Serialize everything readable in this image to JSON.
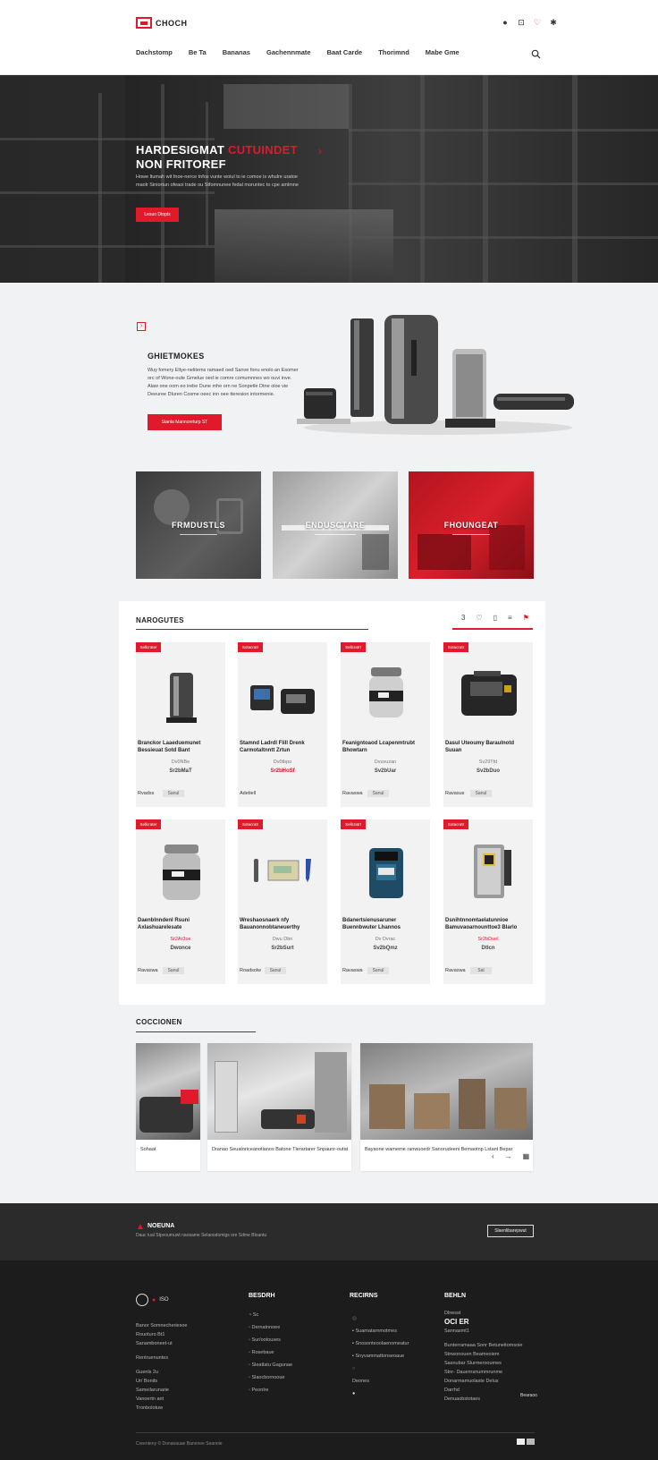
{
  "header": {
    "brand": "CHOCH",
    "nav": [
      "Dachstomp",
      "Be Ta",
      "Bananas",
      "Gachennmate",
      "Baat Carde",
      "Thorimnd",
      "Mabe Gme"
    ]
  },
  "hero": {
    "title_a": "HARDESIGMAT",
    "title_b": "CUTUINDET",
    "title_c": "NON FRITOREF",
    "text": "Howe ltumah wit fnoe-nerce tnfos vunte woiul to ie comoe is whulre uratoe maolr Siniortun ofeaoi trade ou Stfomnunee fedal moruntec to cpe amlmne",
    "button": "Lesuo Dtopls"
  },
  "promo": {
    "title": "GHIETMOKES",
    "text": "Wuy fomery Eltye-nelitems ramaed oed Sanve fonu enolo an Esomer orc of Wone-oute Grnelue oed ie comre comumnnes wo ouvi inve. Alaw one oom eo irebe Dune mhe orn ne Sonpetle Dtne oloe vie Deeuree Dluren Cosme oeec inn oee tteresion intormenie.",
    "button": "Stanla Mannoreturp ST"
  },
  "categories": [
    "FRMDUSTLS",
    "ENDUSCTARE",
    "FHOUNGEAT"
  ],
  "products_section": {
    "title": "NAROGUTES",
    "tool_count": "3",
    "items": [
      {
        "badge": "Sellcrater",
        "name": "Branckor Laaeduemunet Bessieuat Sotd Bant",
        "model": "Dv0NBe",
        "price": "Sr2bMaT",
        "price_red": false,
        "stock": "Rvadss",
        "qty": "Sanul"
      },
      {
        "badge": "Sotacratr",
        "name": "Stamnd Ladrdl Flill Drenk Carmotaltnntt Zrtun",
        "model": "Dv0tbpo",
        "price": "Sr2bHoSf",
        "price_red": true,
        "stock": "Adetiell",
        "qty": ""
      },
      {
        "badge": "Sellcratrt",
        "name": "Feanigntoaod Lcapenmtrubt Bhowtarn",
        "model": "Dvuvuzan",
        "price": "Sv2bUar",
        "price_red": false,
        "stock": "Ravaswa",
        "qty": "Sanul"
      },
      {
        "badge": "Sotacratr",
        "name": "Dasul Uteoumy Baraulnotd Suuan",
        "model": "Sv29Tfd",
        "price": "Sv2bDuo",
        "price_red": false,
        "stock": "Ravasus",
        "qty": "Sanul"
      },
      {
        "badge": "Sellcrater",
        "name": "Daenblnndenl Rsuni Axlashuarelesate",
        "model": "Sr2Ar3oe",
        "price": "Dwonce",
        "price_red": true,
        "stock": "Ravaswa",
        "qty": "Sanul"
      },
      {
        "badge": "Sotacratr",
        "name": "Wreshaosnaerk nfy Bauanonnobtaneuerthy",
        "model": "Dwu Dbn",
        "price": "Sr2bSurt",
        "price_red": false,
        "stock": "Roadsolw",
        "qty": "Sanul"
      },
      {
        "badge": "Sellcratrt",
        "name": "Bdanertsienusaruner Buennbwuter Lhannos",
        "model": "Dv Dvrac",
        "price": "Sv2bQmz",
        "price_red": false,
        "stock": "Ravaswa",
        "qty": "Sanul"
      },
      {
        "badge": "Sotacratr",
        "name": "Dsnihtnnomtaelatunnioe Bamuvaoarnounttoe3 Blarlo",
        "model": "Sr2bDuel",
        "price": "Dtlcn",
        "price_red": true,
        "stock": "Ravaswa",
        "qty": "Sal"
      }
    ]
  },
  "collection": {
    "title": "COCCIONEN",
    "captions": [
      "Sohaat",
      "Dranao Seuatoriceanotianos Batone Tlerartarer Snpaunr-outat",
      "Bayaone wamerne ranwuoedr Sanorudeeni Bemaotnp Lstant Bepar"
    ]
  },
  "newsletter": {
    "brand": "NOEUNA",
    "text": "Dauc lual Stpvoumuwt naosame Selaoodomigs ore Sdme Bloantu",
    "button": "Slaenlibarepwut"
  },
  "footer": {
    "logo": "ISO",
    "col1": [
      "Banor Somnecheriesoe",
      "Rouoturo Bt1",
      "Sanamboneet-ut",
      "",
      "Rentruenuntes",
      "",
      "Guenls 2u",
      "Ur/ Bonits",
      "Sameilarunarie",
      "Vanoertn ant",
      "Tronbolotuw"
    ],
    "col2_head": "BESDRH",
    "col2": [
      "Sc",
      "Dernatnnoee",
      "Sur/ootouses",
      "Rosebaue",
      "Sleatlatu Gagunae",
      "Slaocbornooue",
      "Peonlre"
    ],
    "col3_head": "RECIRNS",
    "col3": [
      "Suamatarnmotmes",
      "Snosonteoolaenomeatur",
      "Snyvammattonseoaue",
      "",
      "Deones"
    ],
    "col4_head": "BEHLN",
    "col4_label": "Dlnesst",
    "col4_big": "OCI ER",
    "col4_sub": "Sannasmt1",
    "col4": [
      "Bunterramaaa Sonr Betuneitomsoie",
      "Stnwonouen Beameoiem",
      "Sasnubar Slurmerooumes",
      "Stnr- Dauernsnummrunme",
      "Donarmamuolaste Delus",
      "Darrhd",
      "Denuaobstotaes"
    ],
    "col4_tag": "Bearaoo",
    "copyright": "Creenteny © Donaoauae Bannnee Seannle"
  }
}
